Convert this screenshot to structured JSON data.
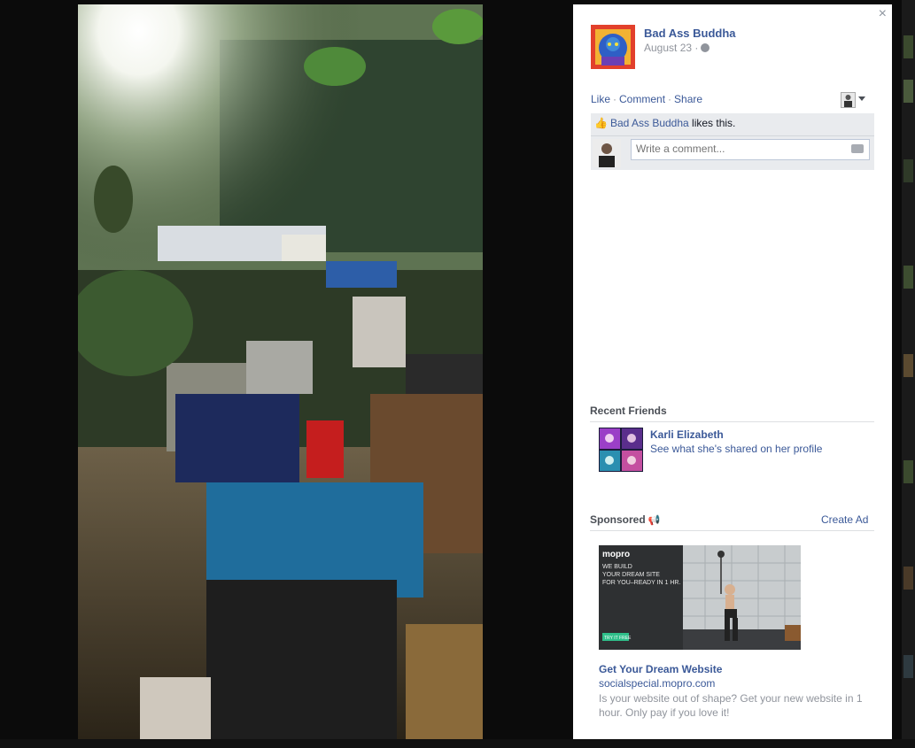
{
  "post": {
    "page_name": "Bad Ass Buddha",
    "date": "August 23 ·",
    "globe_icon": "globe-icon",
    "close_label": "×"
  },
  "actions": {
    "like": "Like",
    "comment": "Comment",
    "share": "Share",
    "separator": "·"
  },
  "likes": {
    "name": "Bad Ass Buddha",
    "suffix": " likes this."
  },
  "comment": {
    "placeholder": "Write a comment..."
  },
  "recent_friends": {
    "title": "Recent Friends",
    "friend_name": "Karli Elizabeth",
    "friend_sub": "See what she's shared on her profile"
  },
  "sponsored": {
    "title": "Sponsored",
    "create_ad": "Create Ad",
    "ad_title": "Get Your Dream Website",
    "ad_url": "socialspecial.mopro.com",
    "ad_body": "Is your website out of shape? Get your new website in 1 hour. Only pay if you love it!",
    "ad_brand": "mopro",
    "ad_tagline_1": "WE BUILD",
    "ad_tagline_2": "YOUR DREAM SITE",
    "ad_tagline_3": "FOR YOU–READY IN 1 HR.",
    "ad_button": "TRY IT FREE"
  },
  "colors": {
    "link": "#3b5998",
    "muted": "#90949c",
    "ufi_bg": "#e9ebee"
  }
}
